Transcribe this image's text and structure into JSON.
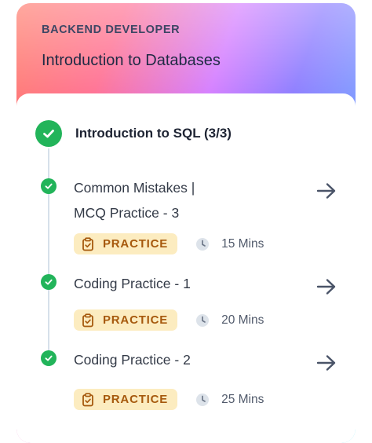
{
  "header": {
    "eyebrow": "BACKEND DEVELOPER",
    "title": "Introduction to Databases"
  },
  "section": {
    "title": "Introduction to SQL (3/3)",
    "status_icon": "check-circle-icon",
    "status_color": "#22b45a"
  },
  "items": [
    {
      "title_line1": "Common Mistakes |",
      "title_line2": "MCQ Practice - 3",
      "badge": "PRACTICE",
      "duration": "15 Mins",
      "completed": true
    },
    {
      "title_line1": "Coding Practice - 1",
      "badge": "PRACTICE",
      "duration": "20 Mins",
      "completed": true
    },
    {
      "title_line1": "Coding Practice - 2",
      "badge": "PRACTICE",
      "duration": "25 Mins",
      "completed": true
    }
  ],
  "colors": {
    "badge_bg": "#fcecc0",
    "badge_text": "#a6590d",
    "complete": "#22b45a"
  }
}
